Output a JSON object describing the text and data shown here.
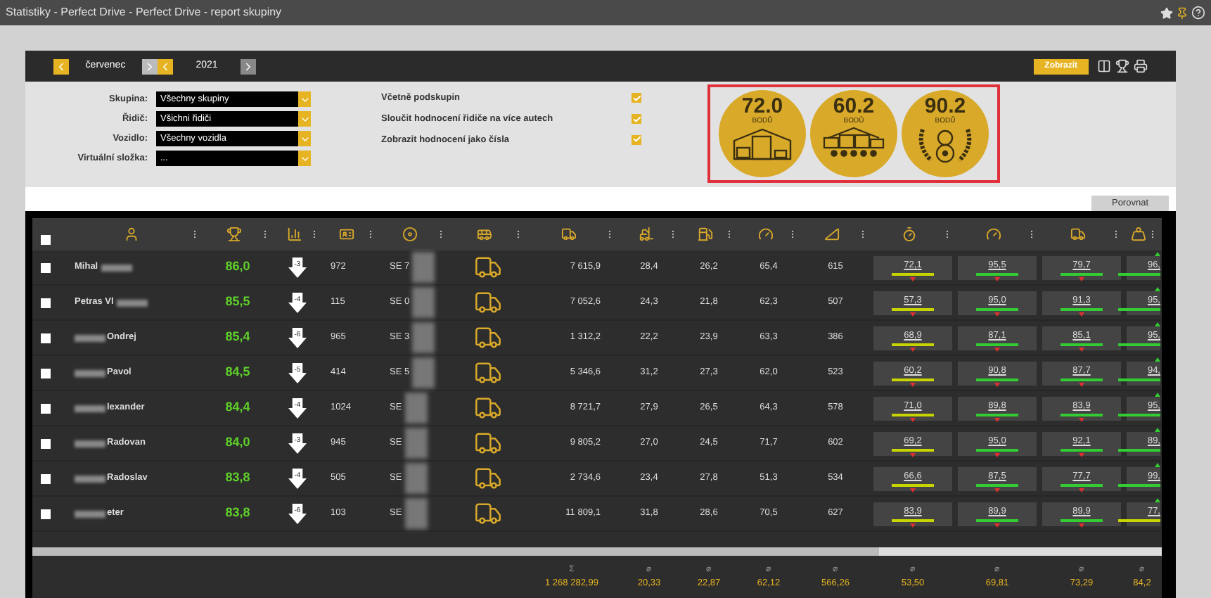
{
  "window": {
    "title": "Statistiky - Perfect Drive - Perfect Drive - report skupiny"
  },
  "period": {
    "month": "červenec",
    "year": "2021"
  },
  "toolbar": {
    "show_button": "Zobrazit"
  },
  "filters": [
    {
      "label": "Skupina:",
      "value": "Všechny skupiny"
    },
    {
      "label": "Řidič:",
      "value": "Všichni řidiči"
    },
    {
      "label": "Vozidlo:",
      "value": "Všechny vozidla"
    },
    {
      "label": "Virtuální složka:",
      "value": "..."
    }
  ],
  "options": [
    {
      "label": "Včetně podskupin",
      "checked": true
    },
    {
      "label": "Sloučit hodnocení řidiče na více autech",
      "checked": true
    },
    {
      "label": "Zobrazit hodnocení jako čísla",
      "checked": true
    }
  ],
  "badges": [
    {
      "kind": "garage",
      "score": "72.0",
      "unit": "BODŮ"
    },
    {
      "kind": "fleet",
      "score": "60.2",
      "unit": "BODŮ"
    },
    {
      "kind": "driver",
      "score": "90.2",
      "unit": "BODŮ"
    }
  ],
  "compare_button": "Porovnat",
  "table": {
    "header_checked": false,
    "rows": [
      {
        "checked": false,
        "name": "Mihal",
        "blur_before_name": false,
        "score": "86,0",
        "rank_change": "-3",
        "column_4": "972",
        "plate": "SE 7",
        "km": "7 615,9",
        "column_9": "28,4",
        "column_10": "26,2",
        "column_11": "65,4",
        "column_12": "615",
        "ratings": [
          {
            "value": "72,1",
            "color": "#c8d400",
            "trend_up": false
          },
          {
            "value": "95,5",
            "color": "#33cc33",
            "trend_up": false
          },
          {
            "value": "79,7",
            "color": "#33cc33",
            "trend_up": false
          },
          {
            "value": "96,",
            "color": "#33cc33",
            "trend_up": true
          }
        ]
      },
      {
        "checked": false,
        "name": "Petras Vl",
        "blur_before_name": false,
        "score": "85,5",
        "rank_change": "-4",
        "column_4": "115",
        "plate": "SE 0",
        "km": "7 052,6",
        "column_9": "24,3",
        "column_10": "21,8",
        "column_11": "62,3",
        "column_12": "507",
        "ratings": [
          {
            "value": "57,3",
            "color": "#c8d400",
            "trend_up": false
          },
          {
            "value": "95,0",
            "color": "#33cc33",
            "trend_up": false
          },
          {
            "value": "91,3",
            "color": "#33cc33",
            "trend_up": false
          },
          {
            "value": "95,",
            "color": "#33cc33",
            "trend_up": true
          }
        ]
      },
      {
        "checked": false,
        "name": "Ondrej",
        "blur_before_name": true,
        "score": "85,4",
        "rank_change": "-6",
        "column_4": "965",
        "plate": "SE 3",
        "km": "1 312,2",
        "column_9": "22,2",
        "column_10": "23,9",
        "column_11": "63,3",
        "column_12": "386",
        "ratings": [
          {
            "value": "68,9",
            "color": "#c8d400",
            "trend_up": false
          },
          {
            "value": "87,1",
            "color": "#33cc33",
            "trend_up": false
          },
          {
            "value": "85,1",
            "color": "#33cc33",
            "trend_up": false
          },
          {
            "value": "95,",
            "color": "#33cc33",
            "trend_up": true
          }
        ]
      },
      {
        "checked": false,
        "name": "Pavol",
        "blur_before_name": true,
        "score": "84,5",
        "rank_change": "-5",
        "column_4": "414",
        "plate": "SE 5",
        "km": "5 346,6",
        "column_9": "31,2",
        "column_10": "27,3",
        "column_11": "62,0",
        "column_12": "523",
        "ratings": [
          {
            "value": "60,2",
            "color": "#c8d400",
            "trend_up": false
          },
          {
            "value": "90,8",
            "color": "#33cc33",
            "trend_up": false
          },
          {
            "value": "87,7",
            "color": "#33cc33",
            "trend_up": false
          },
          {
            "value": "94,",
            "color": "#33cc33",
            "trend_up": true
          }
        ]
      },
      {
        "checked": false,
        "name": "lexander",
        "blur_before_name": true,
        "score": "84,4",
        "rank_change": "-4",
        "column_4": "1024",
        "plate": "SE",
        "km": "8 721,7",
        "column_9": "27,9",
        "column_10": "26,5",
        "column_11": "64,3",
        "column_12": "578",
        "ratings": [
          {
            "value": "71,0",
            "color": "#c8d400",
            "trend_up": false
          },
          {
            "value": "89,8",
            "color": "#33cc33",
            "trend_up": false
          },
          {
            "value": "83,9",
            "color": "#33cc33",
            "trend_up": false
          },
          {
            "value": "95,",
            "color": "#33cc33",
            "trend_up": true
          }
        ]
      },
      {
        "checked": false,
        "name": "Radovan",
        "blur_before_name": true,
        "score": "84,0",
        "rank_change": "-3",
        "column_4": "945",
        "plate": "SE",
        "km": "9 805,2",
        "column_9": "27,0",
        "column_10": "24,5",
        "column_11": "71,7",
        "column_12": "602",
        "ratings": [
          {
            "value": "69,2",
            "color": "#c8d400",
            "trend_up": false
          },
          {
            "value": "95,0",
            "color": "#33cc33",
            "trend_up": false
          },
          {
            "value": "92,1",
            "color": "#33cc33",
            "trend_up": false
          },
          {
            "value": "89,",
            "color": "#33cc33",
            "trend_up": true
          }
        ]
      },
      {
        "checked": false,
        "name": "Radoslav",
        "blur_before_name": true,
        "score": "83,8",
        "rank_change": "-4",
        "column_4": "505",
        "plate": "SE",
        "km": "2 734,6",
        "column_9": "23,4",
        "column_10": "27,8",
        "column_11": "51,3",
        "column_12": "534",
        "ratings": [
          {
            "value": "66,6",
            "color": "#c8d400",
            "trend_up": false
          },
          {
            "value": "87,5",
            "color": "#33cc33",
            "trend_up": false
          },
          {
            "value": "77,7",
            "color": "#33cc33",
            "trend_up": false
          },
          {
            "value": "99,",
            "color": "#33cc33",
            "trend_up": true
          }
        ]
      },
      {
        "checked": false,
        "name": "eter",
        "blur_before_name": true,
        "score": "83,8",
        "rank_change": "-6",
        "column_4": "103",
        "plate": "SE",
        "km": "11 809,1",
        "column_9": "31,8",
        "column_10": "28,6",
        "column_11": "70,5",
        "column_12": "627",
        "ratings": [
          {
            "value": "83,9",
            "color": "#c8d400",
            "trend_up": false
          },
          {
            "value": "89,9",
            "color": "#33cc33",
            "trend_up": false
          },
          {
            "value": "89,9",
            "color": "#33cc33",
            "trend_up": false
          },
          {
            "value": "77,",
            "color": "#c8d400",
            "trend_up": true
          }
        ]
      }
    ],
    "footer": {
      "km": {
        "symbol": "Σ",
        "value": "1 268 282,99"
      },
      "column_9": {
        "symbol": "⌀",
        "value": "20,33"
      },
      "column_10": {
        "symbol": "⌀",
        "value": "22,87"
      },
      "column_11": {
        "symbol": "⌀",
        "value": "62,12"
      },
      "column_12": {
        "symbol": "⌀",
        "value": "566,26"
      },
      "rating_1": {
        "symbol": "⌀",
        "value": "53,50"
      },
      "rating_2": {
        "symbol": "⌀",
        "value": "69,81"
      },
      "rating_3": {
        "symbol": "⌀",
        "value": "73,29"
      },
      "rating_4": {
        "symbol": "⌀",
        "value": "84,2"
      }
    }
  }
}
